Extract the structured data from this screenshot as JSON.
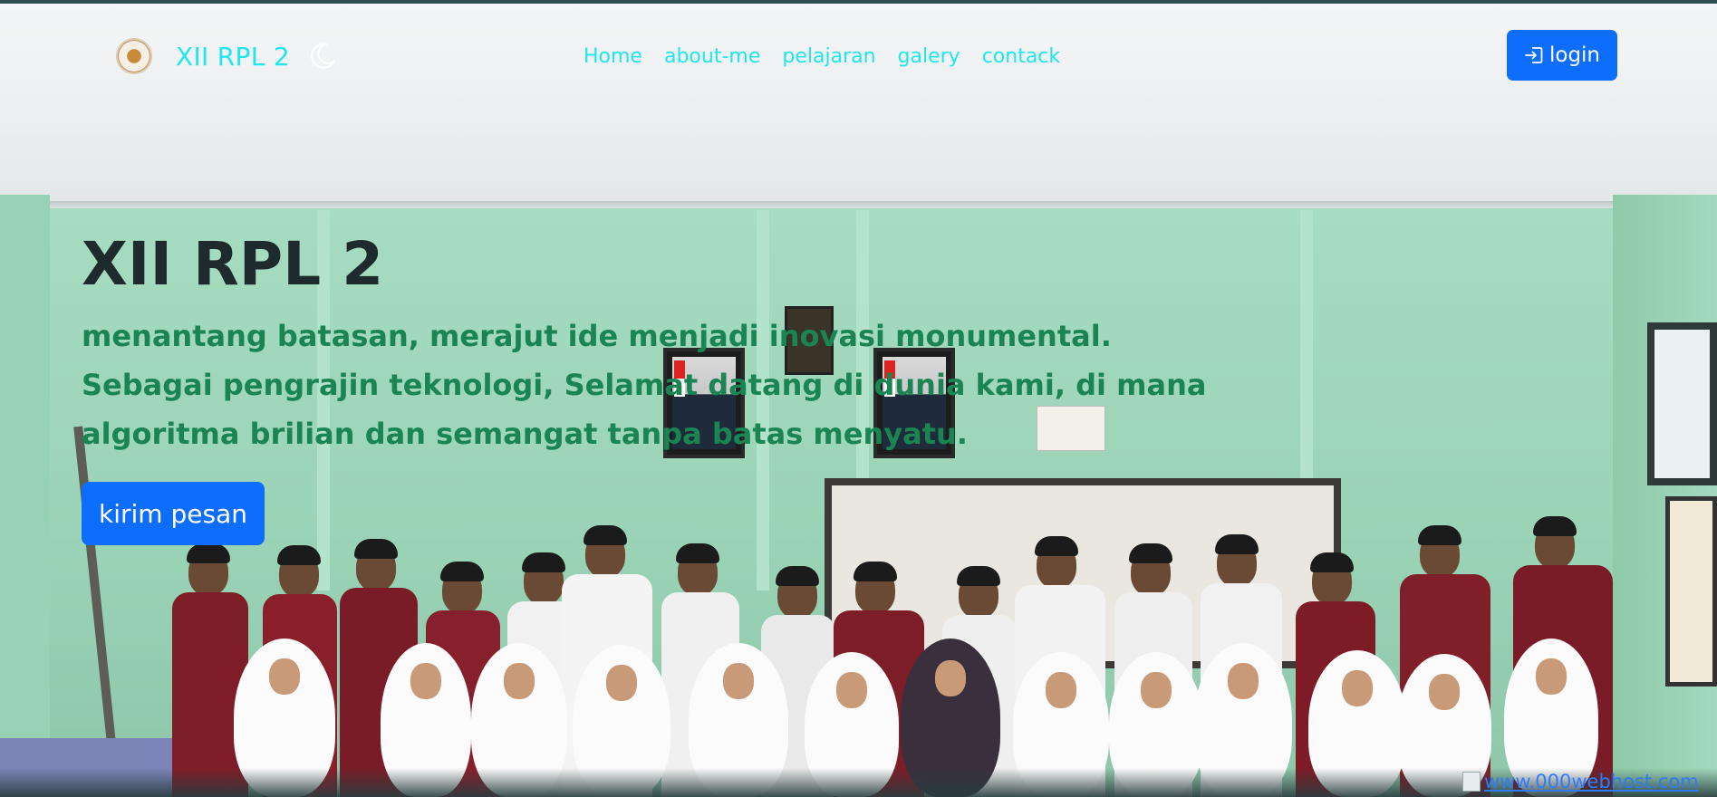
{
  "navbar": {
    "brand_name": "XII RPL 2",
    "links": [
      "Home",
      "about-me",
      "pelajaran",
      "galery",
      "contack"
    ],
    "login_label": "login",
    "link_color": "#1fe6f0"
  },
  "hero": {
    "title": "XII RPL 2",
    "tagline_lines": [
      "menantang batasan, merajut ide menjadi inovasi monumental.",
      "Sebagai pengrajin teknologi, Selamat datang di dunia kami, di mana",
      "algoritma brilian dan semangat tanpa batas menyatu."
    ],
    "cta_label": "kirim pesan",
    "accent_color": "#0d6efd",
    "tagline_color": "#1a8552"
  },
  "footer": {
    "badge_text": "www.000webhost.com"
  },
  "icons": {
    "brand": "school-logo-icon",
    "theme": "moon-icon",
    "login": "login-arrow-icon"
  }
}
